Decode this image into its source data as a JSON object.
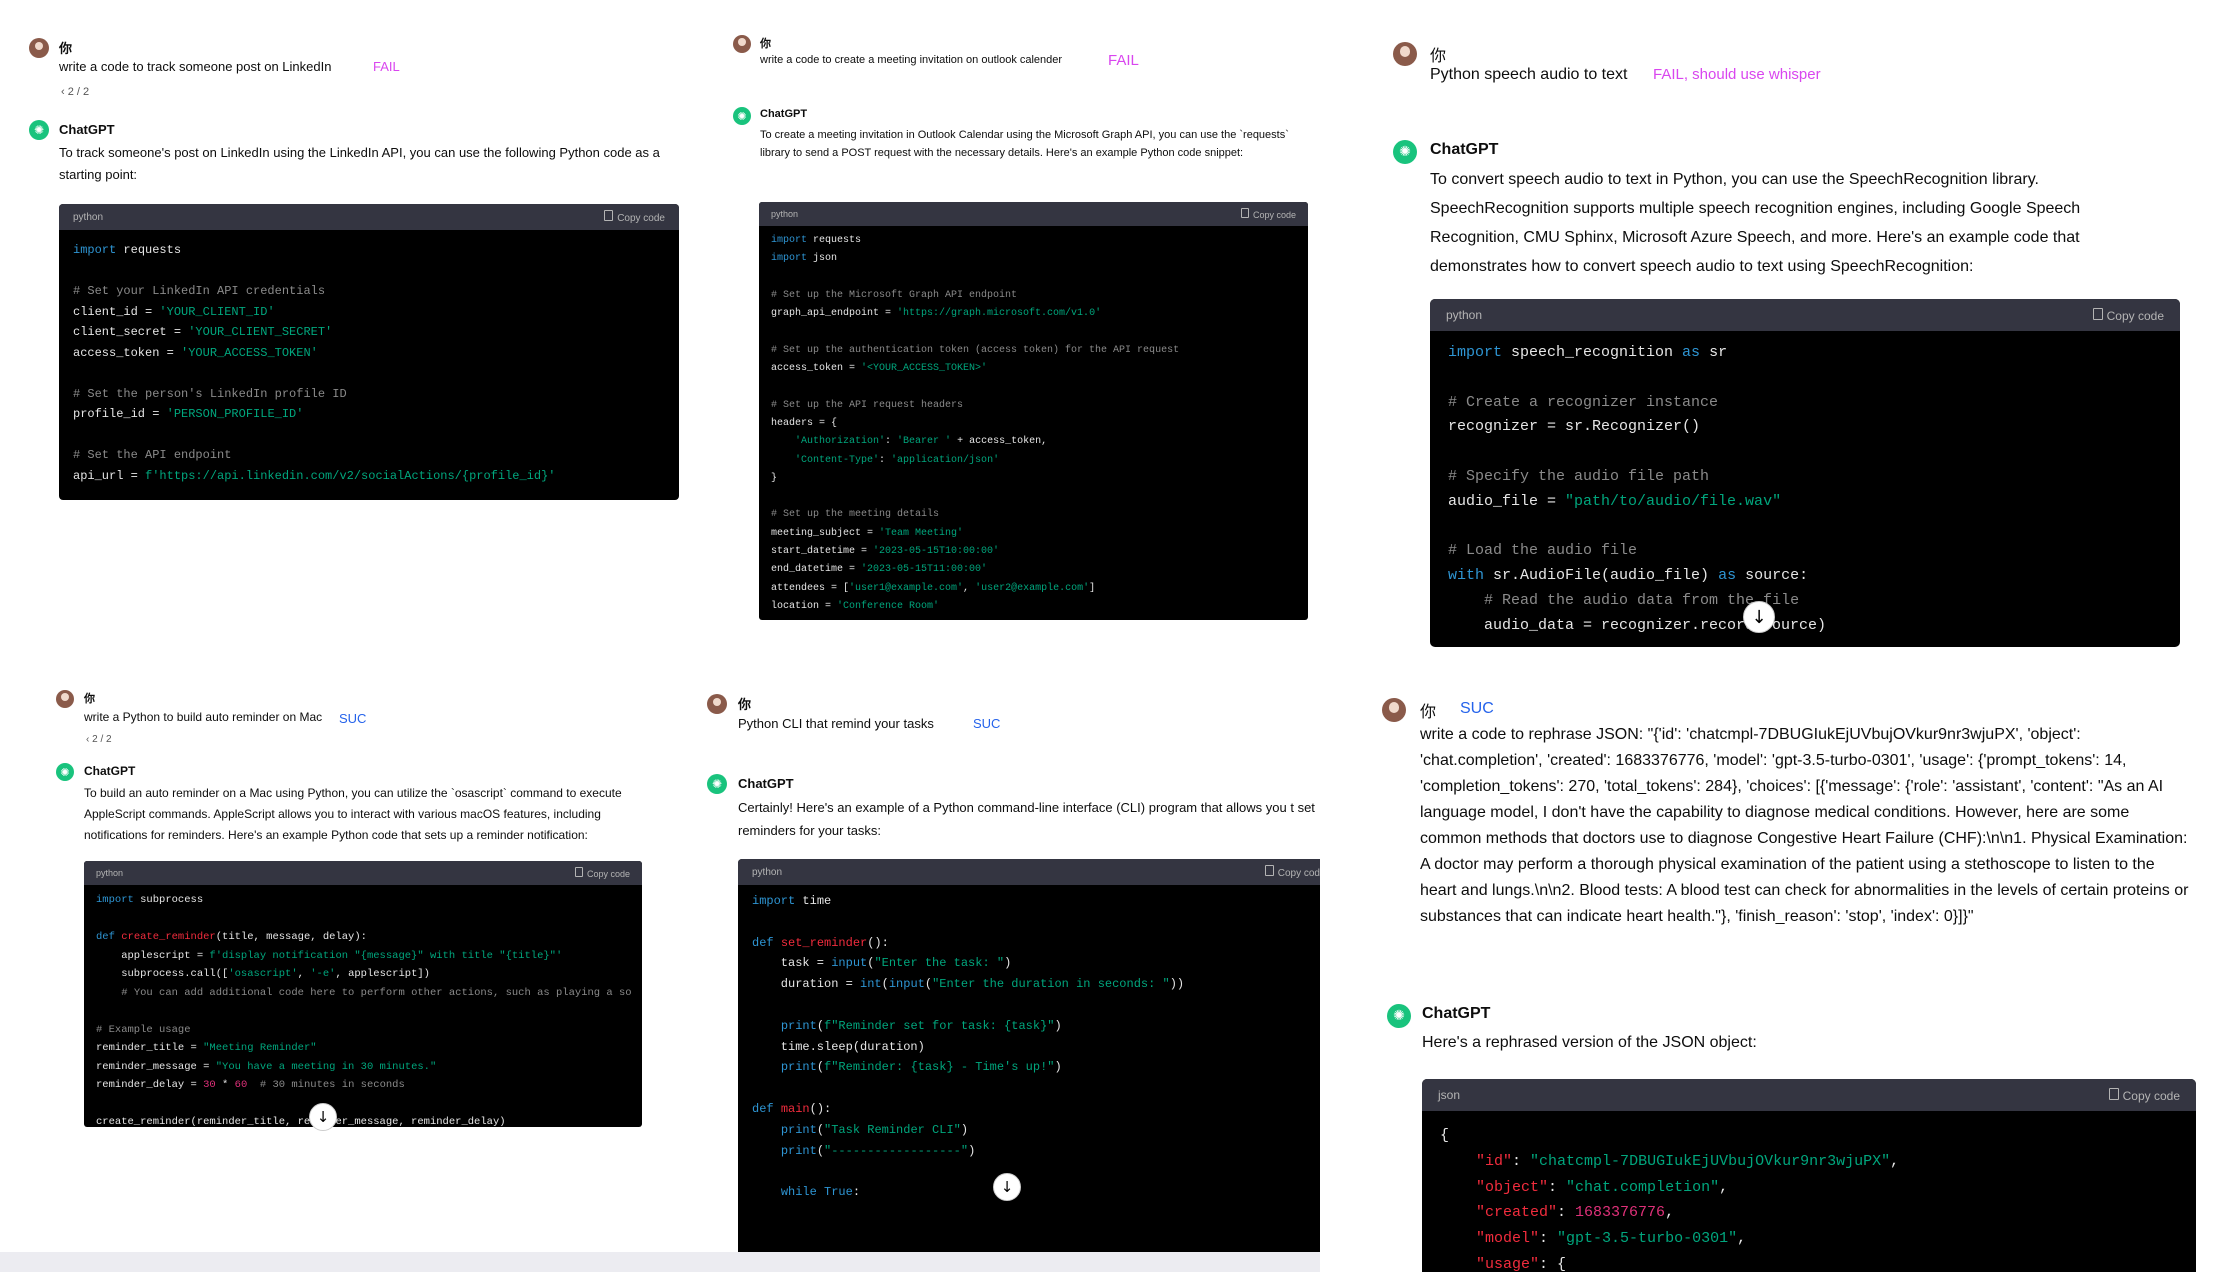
{
  "panels": {
    "p1": {
      "user_name": "你",
      "user_text": "write a code to track someone post on LinkedIn",
      "tag": "FAIL",
      "pager": "‹ 2 / 2",
      "bot_name": "ChatGPT",
      "answer": "To track someone's post on LinkedIn using the LinkedIn API, you can use the following Python code as a starting point:",
      "code_lang": "python",
      "copy_label": "Copy code"
    },
    "p2": {
      "user_name": "你",
      "user_text": "write a code to create a meeting invitation on outlook calender",
      "tag": "FAIL",
      "bot_name": "ChatGPT",
      "answer": "To create a meeting invitation in Outlook Calendar using the Microsoft Graph API, you can use the `requests` library to send a POST request with the necessary details. Here's an example Python code snippet:",
      "code_lang": "python",
      "copy_label": "Copy code"
    },
    "p3": {
      "user_name": "你",
      "user_text": "Python speech audio to text",
      "tag": "FAIL, should use whisper",
      "bot_name": "ChatGPT",
      "answer": "To convert speech audio to text in Python, you can use the SpeechRecognition library. SpeechRecognition supports multiple speech recognition engines, including Google Speech Recognition, CMU Sphinx, Microsoft Azure Speech, and more. Here's an example code that demonstrates how to convert speech audio to text using SpeechRecognition:",
      "code_lang": "python",
      "copy_label": "Copy code"
    },
    "p4": {
      "user_name": "你",
      "user_text": "write a Python to build auto reminder on Mac",
      "tag": "SUC",
      "pager": "‹ 2 / 2",
      "bot_name": "ChatGPT",
      "answer": "To build an auto reminder on a Mac using Python, you can utilize the `osascript` command to execute AppleScript commands. AppleScript allows you to interact with various macOS features, including notifications for reminders. Here's an example Python code that sets up a reminder notification:",
      "code_lang": "python",
      "copy_label": "Copy code"
    },
    "p5": {
      "user_name": "你",
      "user_text": "Python CLI that remind your tasks",
      "tag": "SUC",
      "bot_name": "ChatGPT",
      "answer": "Certainly! Here's an example of a Python command-line interface (CLI) program that allows you t set reminders for your tasks:",
      "code_lang": "python",
      "copy_label": "Copy cod"
    },
    "p6": {
      "user_name": "你",
      "tag": "SUC",
      "user_text": "write a code to rephrase JSON: \"{'id': 'chatcmpl-7DBUGIukEjUVbujOVkur9nr3wjuPX', 'object': 'chat.completion', 'created': 1683376776, 'model': 'gpt-3.5-turbo-0301', 'usage': {'prompt_tokens': 14, 'completion_tokens': 270, 'total_tokens': 284}, 'choices': [{'message': {'role': 'assistant', 'content': \"As an AI language model, I don't have the capability to diagnose medical conditions. However, here are some common methods that doctors use to diagnose Congestive Heart Failure (CHF):\\n\\n1. Physical Examination: A doctor may perform a thorough physical examination of the patient using a stethoscope to listen to the heart and lungs.\\n\\n2. Blood tests: A blood test can check for abnormalities in the levels of certain proteins or substances that can indicate heart health.\"}, 'finish_reason': 'stop', 'index': 0}]}\"",
      "bot_name": "ChatGPT",
      "answer": "Here's a rephrased version of the JSON object:",
      "code_lang": "json",
      "copy_label": "Copy code"
    }
  }
}
